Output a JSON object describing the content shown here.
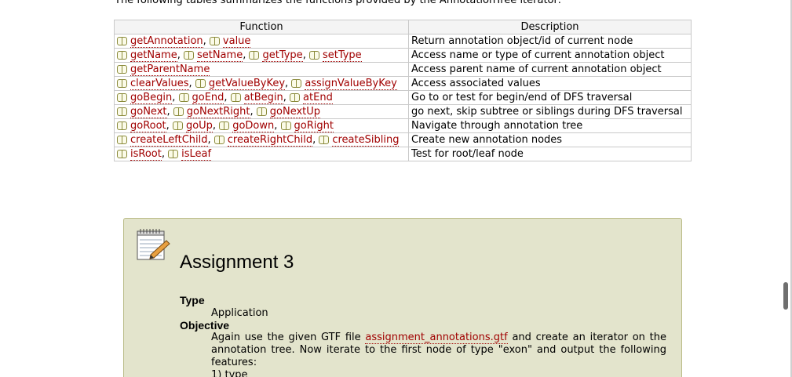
{
  "intro": "The following tables summarizes the functions provided by the AnnotationTree iterator:",
  "table": {
    "headers": [
      "Function",
      "Description"
    ],
    "rows": [
      {
        "funcs": [
          "getAnnotation",
          "value"
        ],
        "desc": "Return annotation object/id of current node"
      },
      {
        "funcs": [
          "getName",
          "setName",
          "getType",
          "setType"
        ],
        "desc": "Access name or type of current annotation object"
      },
      {
        "funcs": [
          "getParentName"
        ],
        "desc": "Access parent name of current annotation object"
      },
      {
        "funcs": [
          "clearValues",
          "getValueByKey",
          "assignValueByKey"
        ],
        "desc": "Access associated values"
      },
      {
        "funcs": [
          "goBegin",
          "goEnd",
          "atBegin",
          "atEnd"
        ],
        "desc": "Go to or test for begin/end of DFS traversal"
      },
      {
        "funcs": [
          "goNext",
          "goNextRight",
          "goNextUp"
        ],
        "desc": "go next, skip subtree or siblings during DFS traversal"
      },
      {
        "funcs": [
          "goRoot",
          "goUp",
          "goDown",
          "goRight"
        ],
        "desc": "Navigate through annotation tree"
      },
      {
        "funcs": [
          "createLeftChild",
          "createRightChild",
          "createSibling"
        ],
        "desc": "Create new annotation nodes"
      },
      {
        "funcs": [
          "isRoot",
          "isLeaf"
        ],
        "desc": "Test for root/leaf node"
      }
    ]
  },
  "assignment": {
    "title": "Assignment 3",
    "type_label": "Type",
    "type_value": "Application",
    "objective_label": "Objective",
    "objective_pre": "Again use the given GTF file",
    "objective_link": "assignment_annotations.gtf",
    "objective_post": "and create an iterator on the annotation tree. Now iterate to the first node of type \"exon\" and output the following features:",
    "list_item": "1) type"
  }
}
